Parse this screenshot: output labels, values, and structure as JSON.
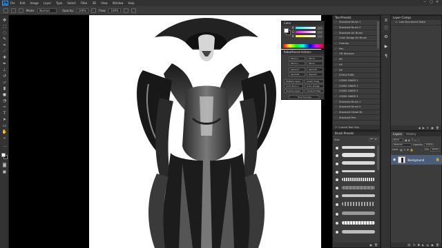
{
  "app": {
    "logo": "Ps"
  },
  "menu": [
    "File",
    "Edit",
    "Image",
    "Layer",
    "Type",
    "Select",
    "Filter",
    "3D",
    "View",
    "Window",
    "Help"
  ],
  "window_controls": [
    "−",
    "▢",
    "✕"
  ],
  "options": {
    "mode_label": "Mode:",
    "mode_value": "Normal",
    "opacity_label": "Opacity:",
    "opacity_value": "100%",
    "flow_label": "Flow:",
    "flow_value": "100%"
  },
  "color_panel": {
    "title": "Color",
    "channels": [
      {
        "ch": "R",
        "value": "255",
        "gradient": "linear-gradient(90deg,#00ffff,#ffffff)"
      },
      {
        "ch": "G",
        "value": "255",
        "gradient": "linear-gradient(90deg,#ff00ff,#ffffff)"
      },
      {
        "ch": "B",
        "value": "255",
        "gradient": "linear-gradient(90deg,#ffff00,#ffffff)"
      }
    ],
    "foreground": "#ffffff",
    "background": "#111111"
  },
  "actions_panel": {
    "title": "RobotFanrel Actions",
    "buttons": [
      "Mirror+",
      "Mirror-",
      "Mirror+",
      "Mirror-",
      "Spiral H",
      "Spiral B",
      "Spiral M",
      "Spiral D",
      "Multiply Layer",
      "Linear Dodg",
      "Color Burn L",
      "Color Dodge",
      "Overlay Layer",
      "Gradient Map"
    ],
    "final_button": "Final Touches"
  },
  "tool_presets": {
    "title": "Tool Presets",
    "items": [
      "Standard Brush 1",
      "Standard Brush 2",
      "Standard Air Brush",
      "Color Dodge Air Brush",
      "Overlay",
      "Pen",
      "OR Textures",
      "ER",
      "HY",
      "HY",
      "STRUCTURE",
      "COMIC INKER 1",
      "COMIC INKER 1",
      "COMIC INKER 2",
      "COMIC INKER 3",
      "Standard Brush 1",
      "Standard Brush 2",
      "Standard Chisel Br",
      "Standard Pen"
    ],
    "footer": "Current Tool Only"
  },
  "brush_presets": {
    "title": "Brush Presets",
    "size_label": "Size:",
    "size_value": "89 px"
  },
  "layer_comps": {
    "title": "Layer Comps",
    "items": [
      "Last Document State"
    ]
  },
  "layers": {
    "tabs": [
      "Layers",
      "History"
    ],
    "kind_label": "Kind",
    "blend": "Normal",
    "opacity_label": "Opacity:",
    "opacity_value": "100%",
    "lock_label": "Lock:",
    "fill_label": "Fill:",
    "fill_value": "100%",
    "layer_name": "Background"
  }
}
